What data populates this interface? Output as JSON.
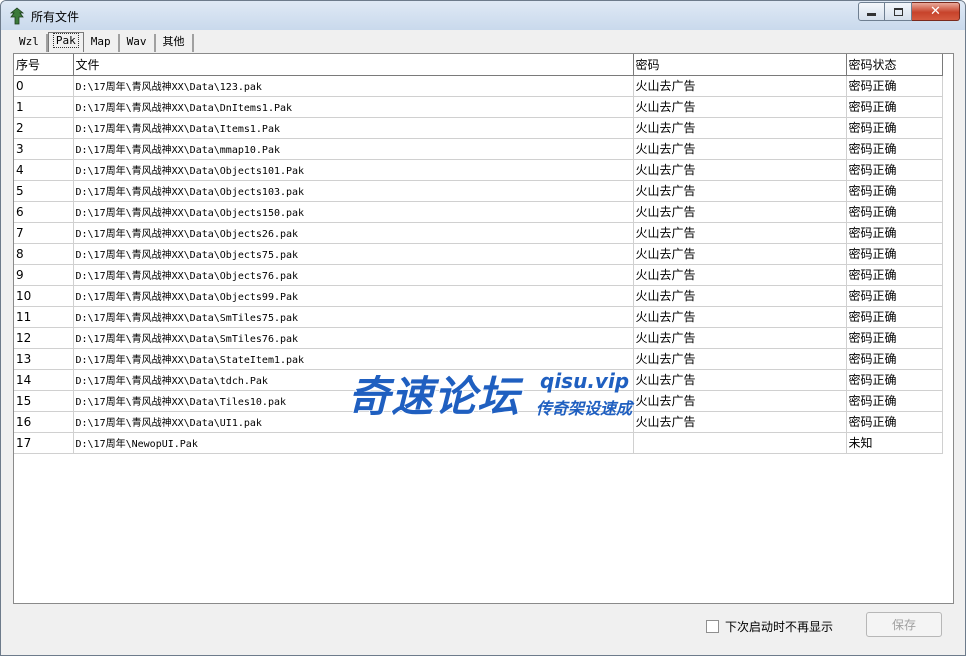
{
  "window": {
    "title": "所有文件"
  },
  "tabs": [
    {
      "label": "Wzl"
    },
    {
      "label": "Pak",
      "active": true
    },
    {
      "label": "Map"
    },
    {
      "label": "Wav"
    },
    {
      "label": "其他"
    }
  ],
  "table": {
    "headers": [
      "序号",
      "文件",
      "密码",
      "密码状态"
    ],
    "rows": [
      [
        "0",
        "D:\\17周年\\青风战神XX\\Data\\123.pak",
        "火山去广告",
        "密码正确"
      ],
      [
        "1",
        "D:\\17周年\\青风战神XX\\Data\\DnItems1.Pak",
        "火山去广告",
        "密码正确"
      ],
      [
        "2",
        "D:\\17周年\\青风战神XX\\Data\\Items1.Pak",
        "火山去广告",
        "密码正确"
      ],
      [
        "3",
        "D:\\17周年\\青风战神XX\\Data\\mmap10.Pak",
        "火山去广告",
        "密码正确"
      ],
      [
        "4",
        "D:\\17周年\\青风战神XX\\Data\\Objects101.Pak",
        "火山去广告",
        "密码正确"
      ],
      [
        "5",
        "D:\\17周年\\青风战神XX\\Data\\Objects103.pak",
        "火山去广告",
        "密码正确"
      ],
      [
        "6",
        "D:\\17周年\\青风战神XX\\Data\\Objects150.pak",
        "火山去广告",
        "密码正确"
      ],
      [
        "7",
        "D:\\17周年\\青风战神XX\\Data\\Objects26.pak",
        "火山去广告",
        "密码正确"
      ],
      [
        "8",
        "D:\\17周年\\青风战神XX\\Data\\Objects75.pak",
        "火山去广告",
        "密码正确"
      ],
      [
        "9",
        "D:\\17周年\\青风战神XX\\Data\\Objects76.pak",
        "火山去广告",
        "密码正确"
      ],
      [
        "10",
        "D:\\17周年\\青风战神XX\\Data\\Objects99.Pak",
        "火山去广告",
        "密码正确"
      ],
      [
        "11",
        "D:\\17周年\\青风战神XX\\Data\\SmTiles75.pak",
        "火山去广告",
        "密码正确"
      ],
      [
        "12",
        "D:\\17周年\\青风战神XX\\Data\\SmTiles76.pak",
        "火山去广告",
        "密码正确"
      ],
      [
        "13",
        "D:\\17周年\\青风战神XX\\Data\\StateItem1.pak",
        "火山去广告",
        "密码正确"
      ],
      [
        "14",
        "D:\\17周年\\青风战神XX\\Data\\tdch.Pak",
        "火山去广告",
        "密码正确"
      ],
      [
        "15",
        "D:\\17周年\\青风战神XX\\Data\\Tiles10.pak",
        "火山去广告",
        "密码正确"
      ],
      [
        "16",
        "D:\\17周年\\青风战神XX\\Data\\UI1.pak",
        "火山去广告",
        "密码正确"
      ],
      [
        "17",
        "D:\\17周年\\NewopUI.Pak",
        "",
        "未知"
      ]
    ]
  },
  "watermark": {
    "main": "奇速论坛",
    "url": "qisu.vip",
    "slogan": "传奇架设速成"
  },
  "footer": {
    "checkbox_label": "下次启动时不再显示",
    "checkbox_checked": false,
    "save_label": "保存"
  },
  "colors": {
    "accent": "#1f5fc0",
    "close_button": "#c7432b"
  }
}
